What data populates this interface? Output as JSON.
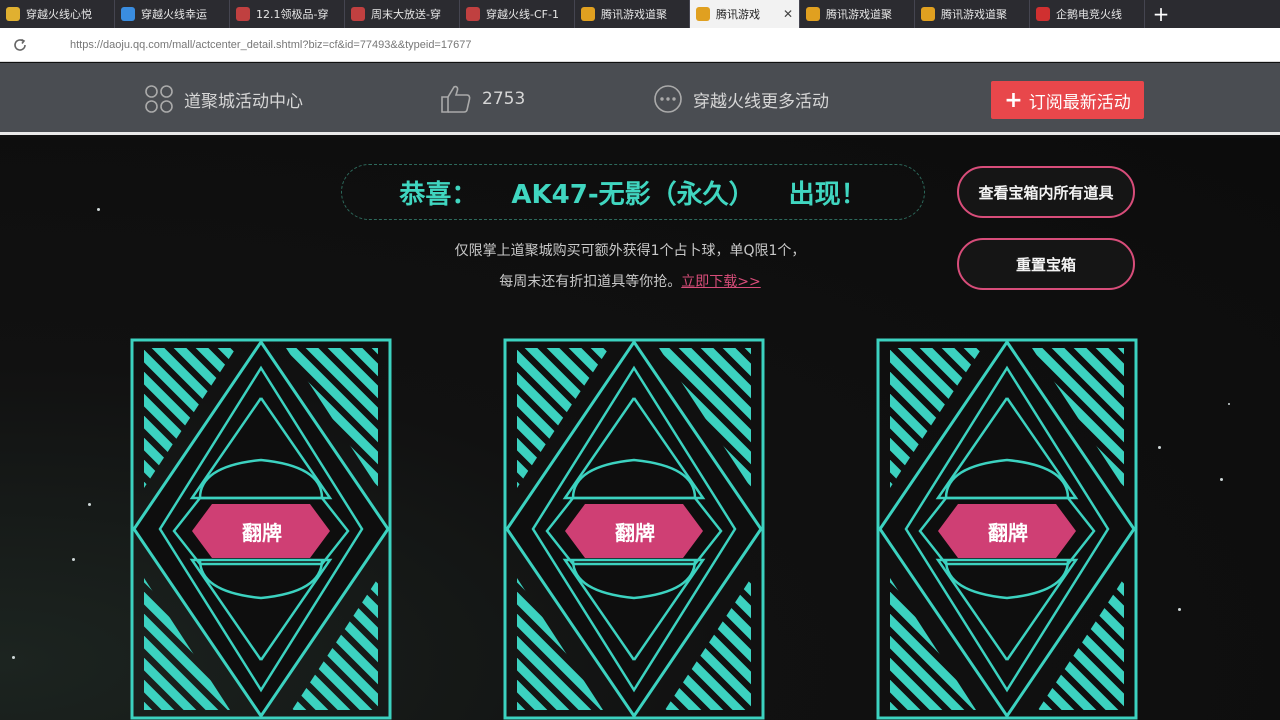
{
  "tabs": [
    {
      "title": "穿越火线心悦",
      "icon_color": "#e0b030",
      "active": false
    },
    {
      "title": "穿越火线幸运",
      "icon_color": "#3a8de0",
      "active": false
    },
    {
      "title": "12.1领极品-穿",
      "icon_color": "#c04040",
      "active": false
    },
    {
      "title": "周末大放送-穿",
      "icon_color": "#c04040",
      "active": false
    },
    {
      "title": "穿越火线-CF-1",
      "icon_color": "#c04040",
      "active": false
    },
    {
      "title": "腾讯游戏道聚",
      "icon_color": "#e0a020",
      "active": false
    },
    {
      "title": "腾讯游戏",
      "icon_color": "#e0a020",
      "active": true
    },
    {
      "title": "腾讯游戏道聚",
      "icon_color": "#e0a020",
      "active": false
    },
    {
      "title": "腾讯游戏道聚",
      "icon_color": "#e0a020",
      "active": false
    },
    {
      "title": "企鹅电竞火线",
      "icon_color": "#d03030",
      "active": false
    }
  ],
  "new_tab": "+",
  "tab_close": "✕",
  "address": {
    "url": "https://daoju.qq.com/mall/actcenter_detail.shtml?biz=cf&id=77493&&typeid=17677"
  },
  "header": {
    "activity_center": "道聚城活动中心",
    "likes": "2753",
    "more_activities": "穿越火线更多活动",
    "subscribe_label": "订阅最新活动",
    "subscribe_plus": "+"
  },
  "banner": {
    "prefix": "恭喜：",
    "item": "AK47-无影（永久）",
    "suffix": "出现！"
  },
  "note": {
    "line1": "仅限掌上道聚城购买可额外获得1个占卜球，单Q限1个，",
    "line2": "每周末还有折扣道具等你抢。",
    "link": "立即下载>>"
  },
  "buttons": {
    "view_items": "查看宝箱内所有道具",
    "reset_box": "重置宝箱"
  },
  "cards": [
    {
      "label": "翻牌"
    },
    {
      "label": "翻牌"
    },
    {
      "label": "翻牌"
    }
  ],
  "colors": {
    "teal": "#3cd2c0",
    "pink": "#cf3f74",
    "subscribe_red": "#e8474b",
    "header_bg": "#4a4d52"
  }
}
